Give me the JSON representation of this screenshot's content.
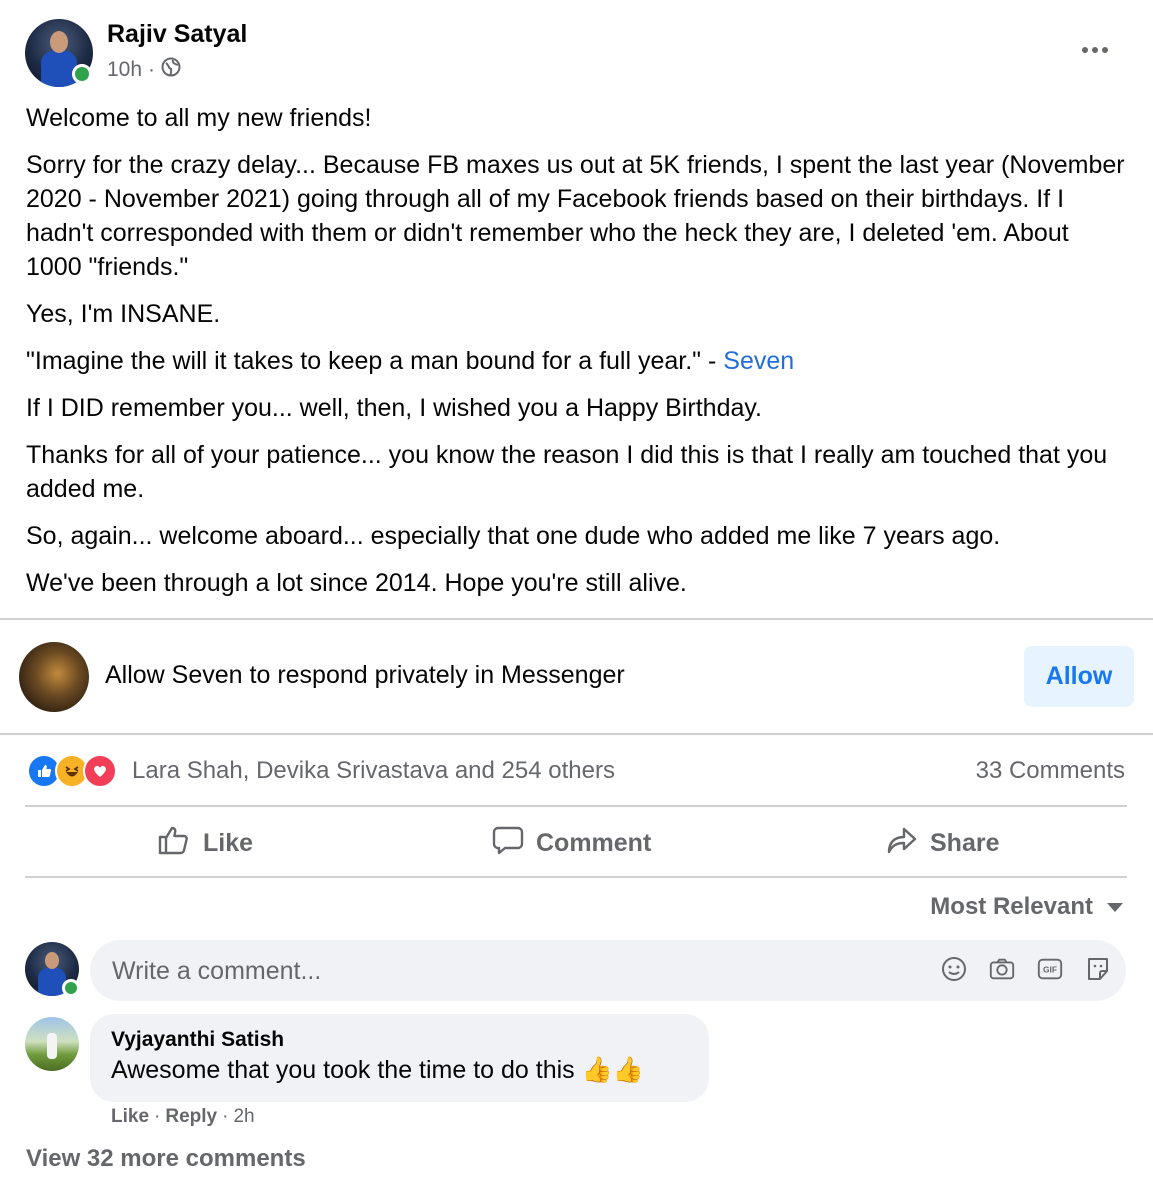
{
  "post": {
    "author": "Rajiv Satyal",
    "time": "10h",
    "separator": "·",
    "audience_icon": "globe-icon",
    "paragraphs": [
      "Welcome to all my new friends!",
      "Sorry for the crazy delay... Because FB maxes us out at 5K friends, I spent the last year (November 2020 - November 2021) going through all of my Facebook friends based on their birthdays.  If I hadn't corresponded with them or didn't remember who the heck they are, I deleted 'em.  About 1000 \"friends.\"",
      "Yes, I'm INSANE.",
      "\"Imagine the will it takes to keep a man bound for a full year.\" - ",
      "If I DID remember you... well, then, I wished you a Happy Birthday.",
      "Thanks for all of your patience... you know the reason I did this is that I really am touched that you added me.",
      "So, again... welcome aboard... especially that one dude who added me like 7 years ago.",
      "We've been through a lot since 2014.  Hope you're still alive."
    ],
    "quote_link": "Seven"
  },
  "messenger_prompt": {
    "text": "Allow Seven to respond privately in Messenger",
    "button": "Allow"
  },
  "reactions": {
    "icons": [
      "like-icon",
      "haha-icon",
      "love-icon"
    ],
    "names": "Lara Shah, Devika Srivastava and 254 others",
    "comment_count": "33 Comments"
  },
  "actions": {
    "like": "Like",
    "comment": "Comment",
    "share": "Share"
  },
  "sort": {
    "label": "Most Relevant"
  },
  "composer": {
    "placeholder": "Write a comment...",
    "icons": [
      "emoji-icon",
      "camera-icon",
      "gif-icon",
      "sticker-icon"
    ]
  },
  "comments": [
    {
      "author": "Vyjayanthi Satish",
      "text": "Awesome that you took the time to do this",
      "emoji": "👍👍",
      "like": "Like",
      "reply": "Reply",
      "time": "2h"
    }
  ],
  "view_more": "View 32 more comments",
  "colors": {
    "accent": "#1877f2",
    "link": "#216fdb",
    "secondary_text": "#65676b",
    "online": "#31a24c",
    "bubble": "#f0f2f5"
  }
}
